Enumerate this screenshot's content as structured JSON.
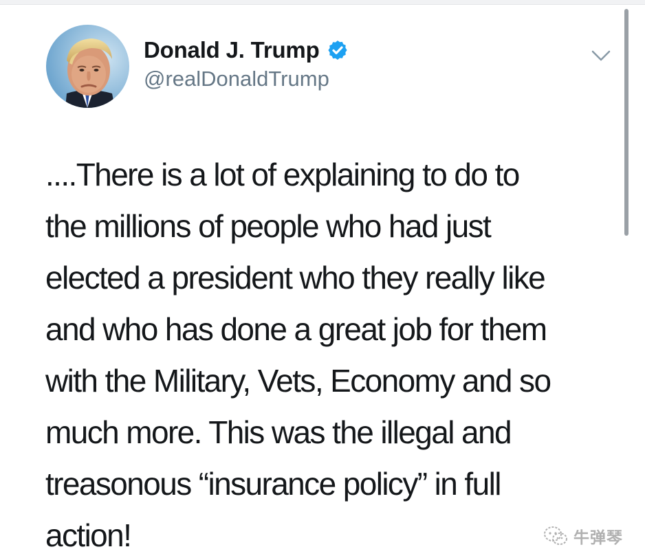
{
  "tweet": {
    "author": {
      "display_name": "Donald J. Trump",
      "handle": "@realDonaldTrump",
      "verified": true
    },
    "text": "....There is a lot of explaining to do to\nthe millions of people who had just\nelected a president who they really like\nand who has done a great job for them\nwith the Military, Vets, Economy and so\nmuch more. This was the illegal and\ntreasonous “insurance policy” in full\naction!"
  },
  "watermark": {
    "text": "牛弹琴"
  },
  "icons": {
    "verified": "verified-badge-icon",
    "menu": "chevron-down-icon",
    "watermark": "wechat-icon"
  },
  "colors": {
    "verified_blue": "#1da1f2",
    "text_primary": "#14171a",
    "text_secondary": "#657786",
    "watermark": "#b0b0b0"
  }
}
